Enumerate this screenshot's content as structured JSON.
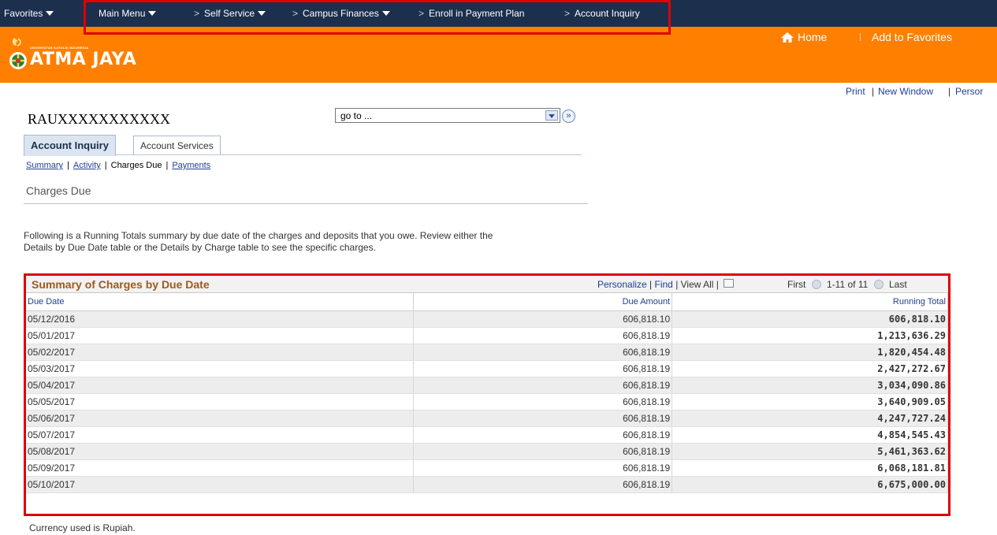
{
  "topnav": {
    "favorites": "Favorites",
    "main_menu": "Main Menu",
    "breadcrumb": [
      "Self Service",
      "Campus Finances",
      "Enroll in Payment Plan",
      "Account Inquiry"
    ]
  },
  "brand": {
    "logo_small": "UNIVERSITAS KATOLIK INDONESIA",
    "logo_big": "ATMA JAYA",
    "home": "Home",
    "add_favorites": "Add to Favorites"
  },
  "utility_links": [
    "Print",
    "New Window",
    "Persor"
  ],
  "user": {
    "name": "RAUXXXXXXXXXXX"
  },
  "goto": {
    "value": "go to ..."
  },
  "tabs": [
    {
      "label": "Account Inquiry",
      "active": true
    },
    {
      "label": "Account Services",
      "active": false
    }
  ],
  "subnav": {
    "summary": "Summary",
    "activity": "Activity",
    "charges_due": "Charges Due",
    "payments": "Payments"
  },
  "page": {
    "title": "Charges Due",
    "intro": "Following is a Running Totals summary by due date of the charges and deposits that you owe. Review either the Details by Due Date table or the Details by Charge table to see the specific charges.",
    "footer_note": "Currency used is Rupiah."
  },
  "grid": {
    "title": "Summary of Charges by Due Date",
    "personalize": "Personalize",
    "find": "Find",
    "view_all": "View All",
    "first": "First",
    "range": "1-11 of 11",
    "last": "Last",
    "columns": [
      "Due Date",
      "Due Amount",
      "Running Total"
    ],
    "rows": [
      [
        "05/12/2016",
        "606,818.10",
        "606,818.10"
      ],
      [
        "05/01/2017",
        "606,818.19",
        "1,213,636.29"
      ],
      [
        "05/02/2017",
        "606,818.19",
        "1,820,454.48"
      ],
      [
        "05/03/2017",
        "606,818.19",
        "2,427,272.67"
      ],
      [
        "05/04/2017",
        "606,818.19",
        "3,034,090.86"
      ],
      [
        "05/05/2017",
        "606,818.19",
        "3,640,909.05"
      ],
      [
        "05/06/2017",
        "606,818.19",
        "4,247,727.24"
      ],
      [
        "05/07/2017",
        "606,818.19",
        "4,854,545.43"
      ],
      [
        "05/08/2017",
        "606,818.19",
        "5,461,363.62"
      ],
      [
        "05/09/2017",
        "606,818.19",
        "6,068,181.81"
      ],
      [
        "05/10/2017",
        "606,818.19",
        "6,675,000.00"
      ]
    ]
  },
  "colors": {
    "nav_bg": "#1c2f4d",
    "brand_orange": "#ff7f00",
    "highlight_red": "#e00000",
    "grid_title": "#9c5a1e",
    "link_blue": "#1f3f8f"
  }
}
